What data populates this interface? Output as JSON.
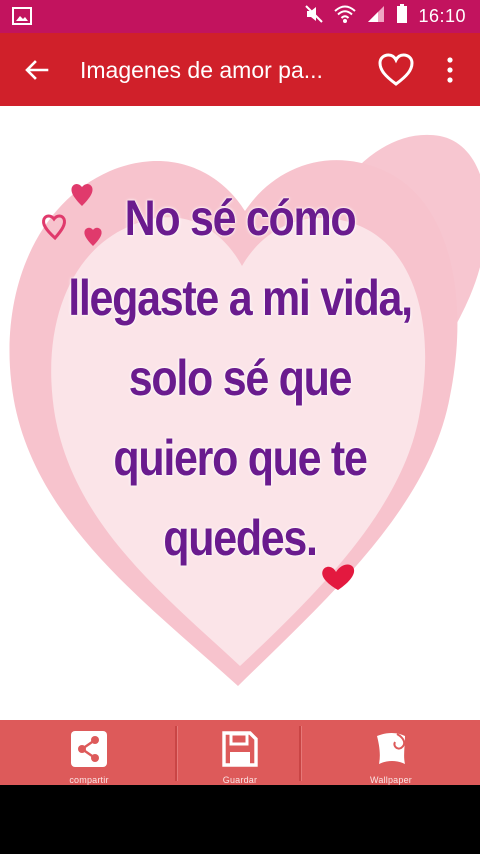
{
  "status_bar": {
    "time": "16:10",
    "icons": [
      "gallery-icon",
      "mute-icon",
      "wifi-icon",
      "signal-icon",
      "battery-icon"
    ]
  },
  "app_bar": {
    "title": "Imagenes de amor pa...",
    "back_icon": "arrow-left-icon",
    "favorite_icon": "heart-outline-icon",
    "menu_icon": "more-vert-icon"
  },
  "content": {
    "quote_lines": [
      "No sé cómo",
      "llegaste a mi vida,",
      "solo sé que",
      "quiero que te",
      "quedes."
    ],
    "colors": {
      "text": "#6a1b8e",
      "heart_outer": "#f7c6d0",
      "heart_inner": "#fbe4e8",
      "accent_heart": "#e3193f"
    }
  },
  "bottom_bar": {
    "buttons": [
      {
        "label": "compartir",
        "icon": "share-icon"
      },
      {
        "label": "Guardar",
        "icon": "save-icon"
      },
      {
        "label": "Wallpaper",
        "icon": "wallpaper-icon"
      }
    ]
  },
  "theme": {
    "status_bar": "#c2135e",
    "app_bar": "#d0202a",
    "bottom_bar": "#dd5a5a"
  }
}
